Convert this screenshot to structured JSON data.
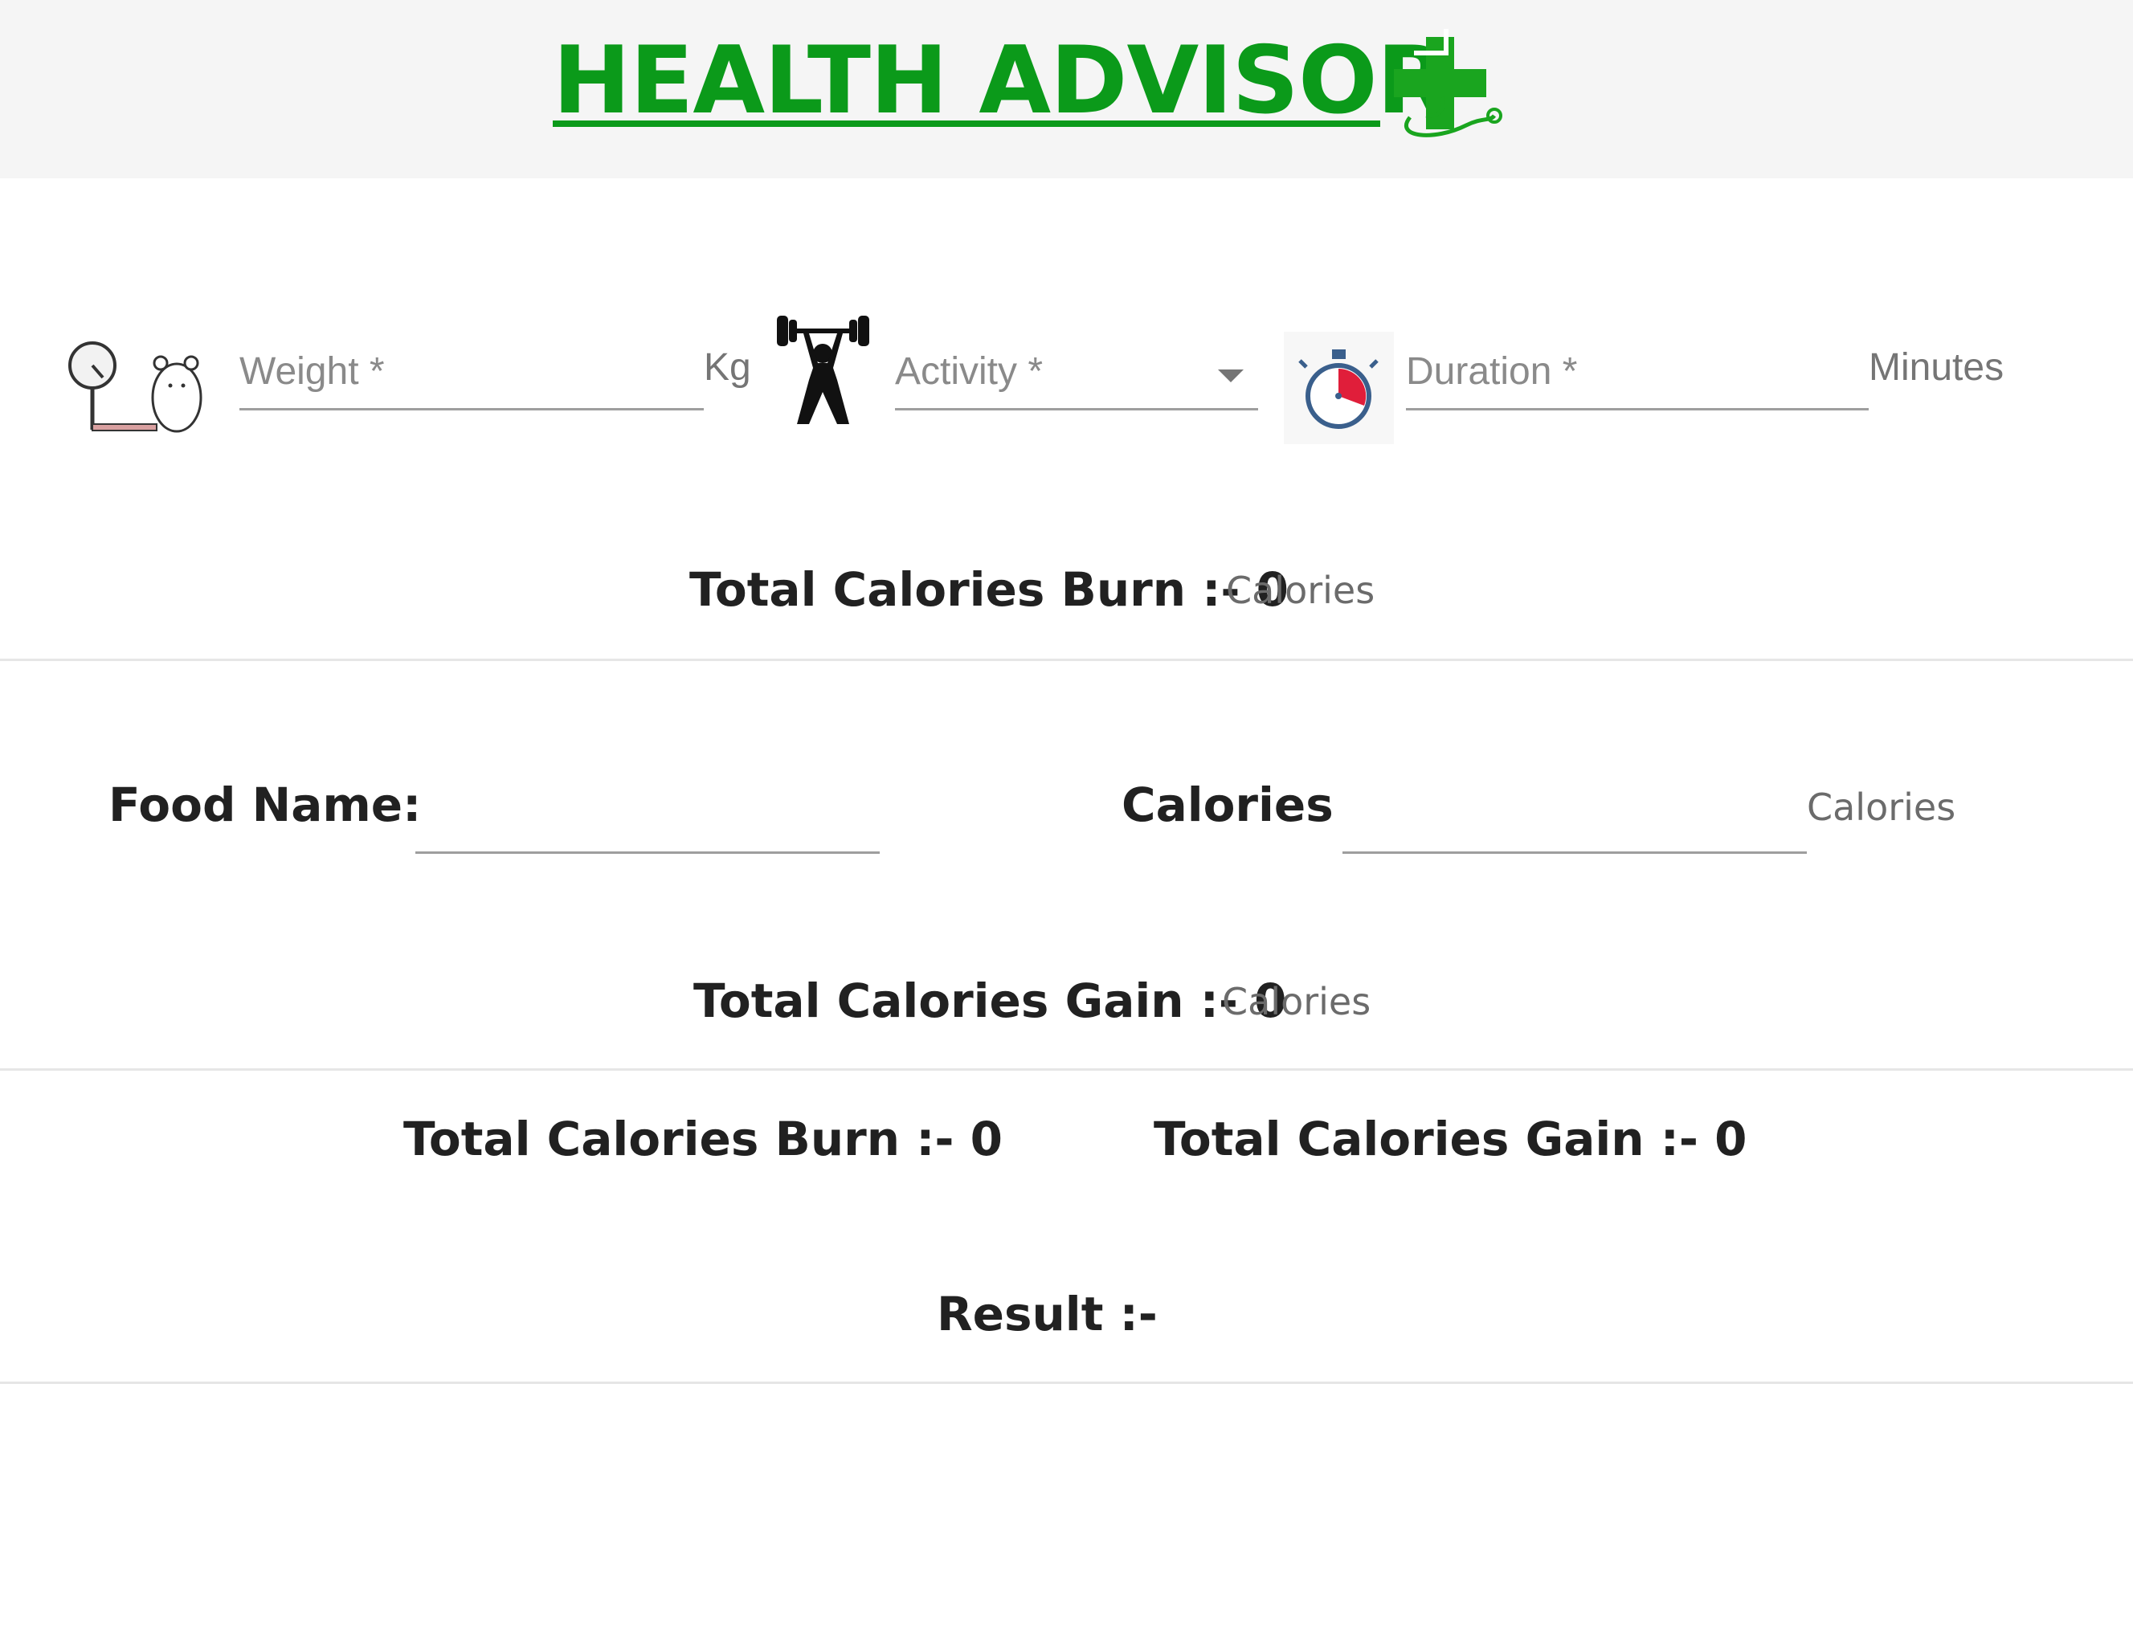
{
  "header": {
    "title": "HEALTH ADVISOR",
    "brand_color": "#0b9a1a"
  },
  "form": {
    "weight": {
      "placeholder": "Weight *",
      "unit": "Kg",
      "icon": "weight-scale-icon"
    },
    "activity": {
      "placeholder": "Activity *",
      "icon": "weightlifter-icon"
    },
    "duration": {
      "placeholder": "Duration *",
      "unit": "Minutes",
      "icon": "stopwatch-icon"
    }
  },
  "burn_section": {
    "label": "Total Calories Burn :- 0",
    "unit": "Calories"
  },
  "food": {
    "name_label": "Food Name:",
    "calories_label": "Calories",
    "calories_unit": "Calories"
  },
  "gain_section": {
    "label": "Total Calories Gain :- 0",
    "unit": "Calories"
  },
  "summary": {
    "burn": "Total Calories Burn :- 0",
    "gain": "Total Calories Gain :- 0",
    "result": "Result :-"
  }
}
